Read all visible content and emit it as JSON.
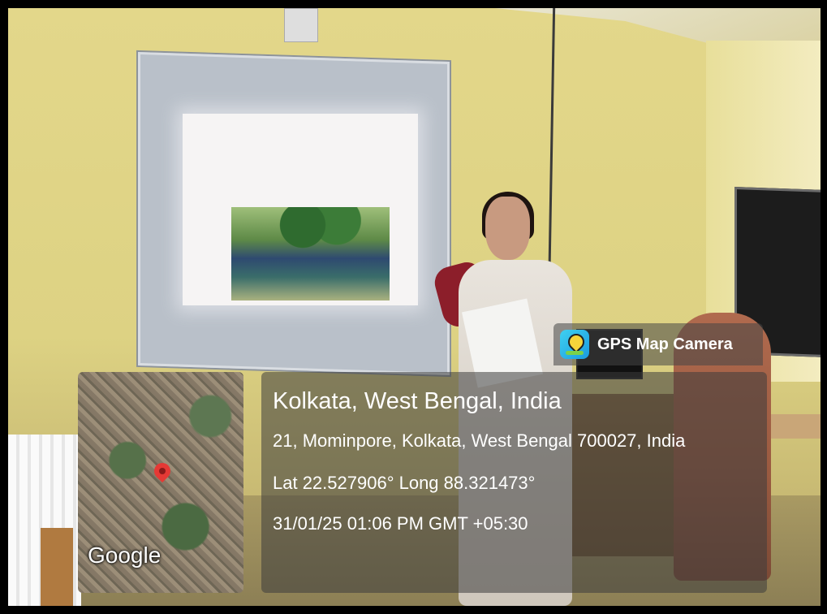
{
  "overlay": {
    "app_name": "GPS Map Camera",
    "map_brand": "Google",
    "location_title": "Kolkata, West Bengal, India",
    "address": "21, Mominpore, Kolkata, West Bengal 700027, India",
    "coordinates": "Lat 22.527906° Long 88.321473°",
    "datetime": "31/01/25 01:06 PM GMT +05:30"
  }
}
